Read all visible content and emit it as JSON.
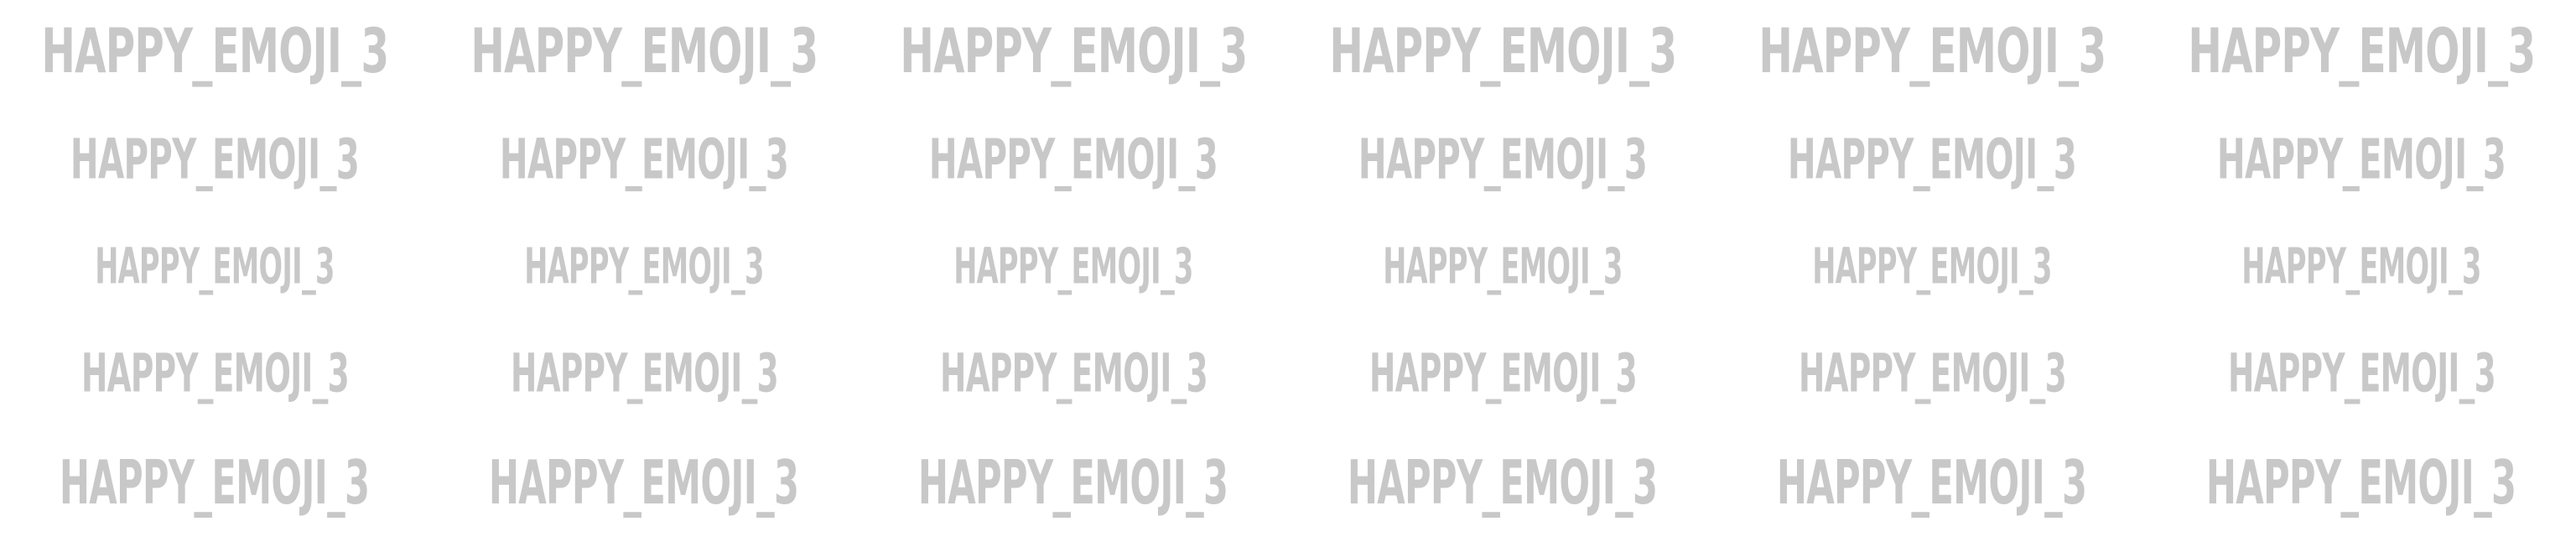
{
  "pattern": {
    "text": "HAPPY_EMOJI_3",
    "color": "#c8c8c8",
    "background": "#ffffff",
    "rows": 5,
    "columns": 6
  }
}
